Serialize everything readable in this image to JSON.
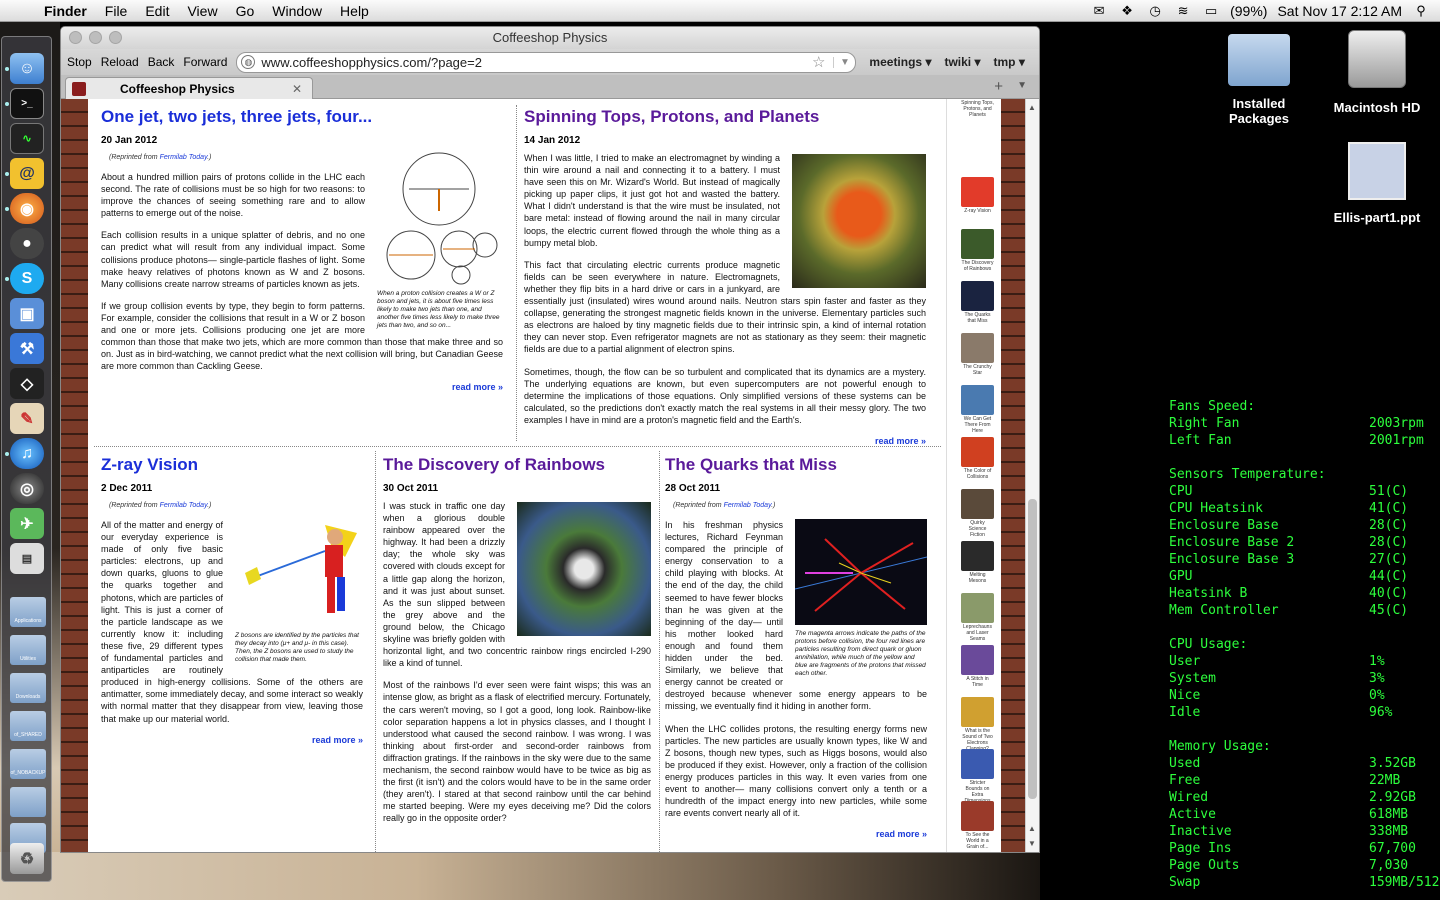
{
  "menubar": {
    "app_name": "Finder",
    "menus": [
      "File",
      "Edit",
      "View",
      "Go",
      "Window",
      "Help"
    ],
    "battery": "(99%)",
    "clock": "Sat Nov 17  2:12 AM"
  },
  "desktop": {
    "icons": [
      "Installed Packages",
      "Macintosh HD",
      "Ellis-part1.ppt"
    ]
  },
  "dock": {
    "folders": [
      "Applications",
      "Utilities",
      "Downloads",
      "of_SHARED",
      "of_NOBACKUP"
    ]
  },
  "browser": {
    "window_title": "Coffeeshop Physics",
    "stop": "Stop",
    "reload": "Reload",
    "back": "Back",
    "forward": "Forward",
    "url": "www.coffeeshopphysics.com/?page=2",
    "bookmarks": [
      "meetings",
      "twiki",
      "tmp"
    ],
    "tab_title": "Coffeeshop Physics",
    "read_more": "read more »"
  },
  "articles": {
    "a1": {
      "title": "One jet, two jets, three jets, four...",
      "date": "20 Jan 2012",
      "reprint_prefix": "(Reprinted from",
      "reprint_source": "Fermilab Today",
      "reprint_suffix": ".)",
      "caption": "When a proton collision creates a W or Z boson and jets, it is about five times less likely to make two jets than one, and another five times less likely to make three jets than two, and so on...",
      "p1": "About a hundred million pairs of protons collide in the LHC each second. The rate of collisions must be so high for two reasons: to improve the chances of seeing something rare and to allow patterns to emerge out of the noise.",
      "p2": "Each collision results in a unique splatter of debris, and no one can predict what will result from any individual impact. Some collisions produce photons— single-particle flashes of light. Some make heavy relatives of photons known as W and Z bosons. Many collisions create narrow streams of particles known as jets.",
      "p3": "If we group collision events by type, they begin to form patterns. For example, consider the collisions that result in a W or Z boson and one or more jets. Collisions producing one jet are more common than those that make two jets, which are more common than those that make three and so on. Just as in bird-watching, we cannot predict what the next collision will bring, but Canadian Geese are more common than Cackling Geese."
    },
    "a2": {
      "title": "Spinning Tops, Protons, and Planets",
      "date": "14 Jan 2012",
      "p1": "When I was little, I tried to make an electromagnet by winding a thin wire around a nail and connecting it to a battery. I must have seen this on Mr. Wizard's World. But instead of magically picking up paper clips, it just got hot and wasted the battery. What I didn't understand is that the wire must be insulated, not bare metal: instead of flowing around the nail in many circular loops, the electric current flowed through the whole thing as a bumpy metal blob.",
      "p2": "This fact that circulating electric currents produce magnetic fields can be seen everywhere in nature. Electromagnets, whether they flip bits in a hard drive or cars in a junkyard, are essentially just (insulated) wires wound around nails. Neutron stars spin faster and faster as they collapse, generating the strongest magnetic fields known in the universe. Elementary particles such as electrons are haloed by tiny magnetic fields due to their intrinsic spin, a kind of internal rotation they can never stop. Even refrigerator magnets are not as stationary as they seem: their magnetic fields are due to a partial alignment of electron spins.",
      "p3": "Sometimes, though, the flow can be so turbulent and complicated that its dynamics are a mystery. The underlying equations are known, but even supercomputers are not powerful enough to determine the implications of those equations. Only simplified versions of these systems can be calculated, so the predictions don't exactly match the real systems in all their messy glory. The two examples I have in mind are a proton's magnetic field and the Earth's."
    },
    "a3": {
      "title": "Z-ray Vision",
      "date": "2 Dec 2011",
      "reprint_prefix": "(Reprinted from",
      "reprint_source": "Fermilab Today",
      "reprint_suffix": ".)",
      "caption": "Z bosons are identified by the particles that they decay into (μ+ and μ- in this case). Then, the Z bosons are used to study the collision that made them.",
      "p1": "All of the matter and energy of our everyday experience is made of only five basic particles: electrons, up and down quarks, gluons to glue the quarks together and photons, which are particles of light. This is just a corner of the particle landscape as we currently know it: including these five, 29 different types of fundamental particles and antiparticles are routinely produced in high-energy collisions. Some of the others are antimatter, some immediately decay, and some interact so weakly with normal matter that they disappear from view, leaving those that make up our material world."
    },
    "a4": {
      "title": "The Discovery of Rainbows",
      "date": "30 Oct 2011",
      "p1": "I was stuck in traffic one day when a glorious double rainbow appeared over the highway. It had been a drizzly day; the whole sky was covered with clouds except for a little gap along the horizon, and it was just about sunset. As the sun slipped between the grey above and the ground below, the Chicago skyline was briefly golden with horizontal light, and two concentric rainbow rings encircled I-290 like a kind of tunnel.",
      "p2": "Most of the rainbows I'd ever seen were faint wisps; this was an intense glow, as bright as a flask of electrified mercury. Fortunately, the cars weren't moving, so I got a good, long look. Rainbow-like color separation happens a lot in physics classes, and I thought I understood what caused the second rainbow. I was wrong. I was thinking about first-order and second-order rainbows from diffraction gratings. If the rainbows in the sky were due to the same mechanism, the second rainbow would have to be twice as big as the first (it isn't) and the colors would have to be in the same order (they aren't). I stared at that second rainbow until the car behind me started beeping. Were my eyes deceiving me? Did the colors really go in the opposite order?"
    },
    "a5": {
      "title": "The Quarks that Miss",
      "date": "28 Oct 2011",
      "reprint_prefix": "(Reprinted from",
      "reprint_source": "Fermilab Today",
      "reprint_suffix": ".)",
      "caption": "The magenta arrows indicate the paths of the protons before collision, the four red lines are particles resulting from direct quark or gluon annihilation, while much of the yellow and blue are fragments of the protons that missed each other.",
      "p1": "In his freshman physics lectures, Richard Feynman compared the principle of energy conservation to a child playing with blocks. At the end of the day, the child seemed to have fewer blocks than he was given at the beginning of the day— until his mother looked hard enough and found them hidden under the bed. Similarly, we believe that energy cannot be created or destroyed because whenever some energy appears to be missing, we eventually find it hiding in another form.",
      "p2": "When the LHC collides protons, the resulting energy forms new particles. The new particles are usually known types, like W and Z bosons, though new types, such as Higgs bosons, would also be produced if they exist. However, only a fraction of the collision energy produces particles in this way. It even varies from one event to another— many collisions convert only a tenth or a hundredth of the impact energy into new particles, while some rare events convert nearly all of it."
    }
  },
  "sidebar_thumbs": [
    {
      "label": "Spinning Tops, Protons, and Planets",
      "color": "#c9a54a"
    },
    {
      "label": "Z-ray Vision",
      "color": "#e23b2a"
    },
    {
      "label": "The Discovery of Rainbows",
      "color": "#3b5a2a"
    },
    {
      "label": "The Quarks that Miss",
      "color": "#1a2340"
    },
    {
      "label": "The Crunchy Star",
      "color": "#8a7a6a"
    },
    {
      "label": "We Can Get There From Here",
      "color": "#4a7ab0"
    },
    {
      "label": "The Color of Collisions",
      "color": "#d04020"
    },
    {
      "label": "Quirky Science Fiction",
      "color": "#5a4a3a"
    },
    {
      "label": "Melting Mesons",
      "color": "#2a2a2a"
    },
    {
      "label": "Leprechauns and Laser Seams",
      "color": "#8a9a6a"
    },
    {
      "label": "A Stitch in Time",
      "color": "#6a4a9a"
    },
    {
      "label": "What is the Sound of Two Electrons Clapping?",
      "color": "#d0a030"
    },
    {
      "label": "Stricter Bounds on Extra Dimensions",
      "color": "#3a5ab0"
    },
    {
      "label": "To See the World in a Grain of...",
      "color": "#9a3a2a"
    }
  ],
  "monitor": {
    "fans": {
      "header": "Fans Speed:",
      "rows": [
        [
          "Right Fan",
          "2003rpm"
        ],
        [
          "Left Fan",
          "2001rpm"
        ]
      ]
    },
    "temps": {
      "header": "Sensors Temperature:",
      "rows": [
        [
          "CPU",
          "51(C)"
        ],
        [
          "CPU Heatsink",
          "41(C)"
        ],
        [
          "Enclosure Base",
          "28(C)"
        ],
        [
          "Enclosure Base 2",
          "28(C)"
        ],
        [
          "Enclosure Base 3",
          "27(C)"
        ],
        [
          "GPU",
          "44(C)"
        ],
        [
          "Heatsink B",
          "40(C)"
        ],
        [
          "Mem Controller",
          "45(C)"
        ]
      ]
    },
    "cpu": {
      "header": "CPU Usage:",
      "rows": [
        [
          "User",
          "1%"
        ],
        [
          "System",
          "3%"
        ],
        [
          "Nice",
          "0%"
        ],
        [
          "Idle",
          "96%"
        ]
      ]
    },
    "memory": {
      "header": "Memory Usage:",
      "rows": [
        [
          "Used",
          "3.52GB"
        ],
        [
          "Free",
          "22MB"
        ],
        [
          "Wired",
          "2.92GB"
        ],
        [
          "Active",
          "618MB"
        ],
        [
          "Inactive",
          "338MB"
        ],
        [
          "Page Ins",
          "67,700"
        ],
        [
          "Page Outs",
          "7,030"
        ],
        [
          "Swap",
          "159MB/512"
        ]
      ]
    }
  }
}
